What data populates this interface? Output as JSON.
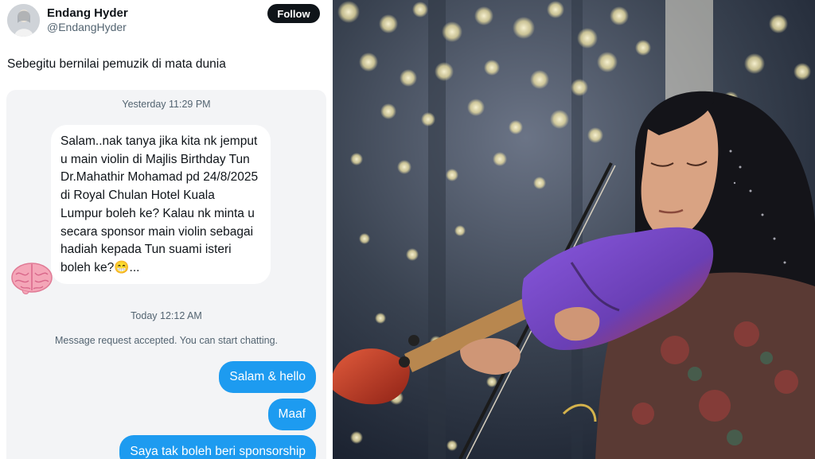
{
  "author": {
    "name": "Endang Hyder",
    "handle": "@EndangHyder",
    "follow_label": "Follow"
  },
  "tweet": {
    "text": "Sebegitu bernilai pemuzik di mata dunia"
  },
  "dm": {
    "timestamp_1": "Yesterday 11:29 PM",
    "incoming_message": "Salam..nak tanya jika kita nk jemput u main violin di Majlis Birthday Tun Dr.Mahathir Mohamad pd 24/8/2025 di Royal Chulan Hotel Kuala Lumpur boleh ke? Kalau nk minta u secara sponsor main violin sebagai hadiah kepada Tun suami isteri boleh ke?😁...",
    "timestamp_2": "Today 12:12 AM",
    "system_message": "Message request accepted. You can start chatting.",
    "outgoing": [
      {
        "text": "Salam & hello"
      },
      {
        "text": "Maaf"
      },
      {
        "text": "Saya tak boleh beri sponsorship"
      }
    ]
  },
  "colors": {
    "accent": "#1d9bf0",
    "follow_bg": "#0f1419",
    "card_bg": "#f3f4f6",
    "violin": "#6a3fb5"
  },
  "icons": {
    "brain": "brain-icon",
    "avatar": "avatar"
  }
}
